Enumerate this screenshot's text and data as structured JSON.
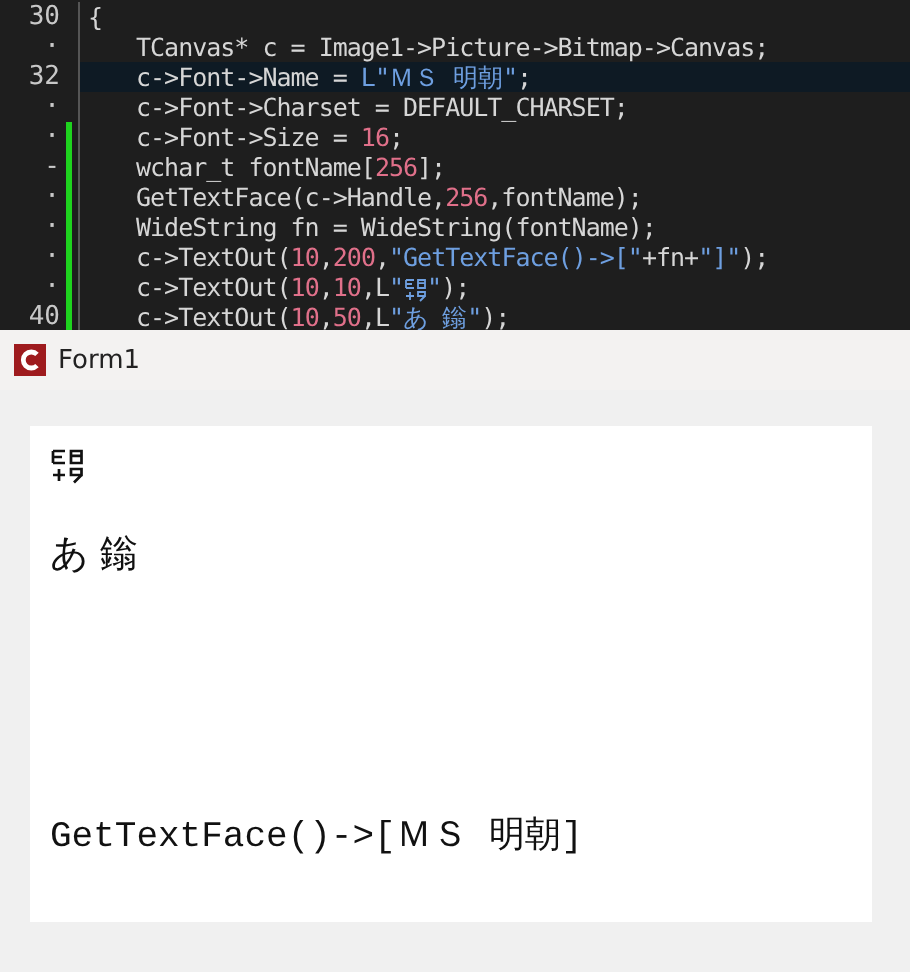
{
  "editor": {
    "lines": [
      {
        "gutter": "30",
        "changed": false,
        "current": false,
        "indented": false,
        "tokens": [
          {
            "kind": "text",
            "text": "{"
          }
        ]
      },
      {
        "gutter": "·",
        "changed": false,
        "current": false,
        "indented": true,
        "tokens": [
          {
            "kind": "text",
            "text": "TCanvas* c = Image1->Picture->Bitmap->Canvas;"
          }
        ]
      },
      {
        "gutter": "32",
        "changed": false,
        "current": true,
        "indented": true,
        "tokens": [
          {
            "kind": "text",
            "text": "c->Font->Name = "
          },
          {
            "kind": "string",
            "text": "L\"ＭＳ 明朝\""
          },
          {
            "kind": "text",
            "text": ";"
          }
        ]
      },
      {
        "gutter": "·",
        "changed": false,
        "current": false,
        "indented": true,
        "tokens": [
          {
            "kind": "text",
            "text": "c->Font->Charset = DEFAULT_CHARSET;"
          }
        ]
      },
      {
        "gutter": "·",
        "changed": true,
        "current": false,
        "indented": true,
        "tokens": [
          {
            "kind": "text",
            "text": "c->Font->Size = "
          },
          {
            "kind": "number",
            "text": "16"
          },
          {
            "kind": "text",
            "text": ";"
          }
        ]
      },
      {
        "gutter": "-",
        "changed": true,
        "current": false,
        "indented": true,
        "tokens": [
          {
            "kind": "text",
            "text": "wchar_t fontName["
          },
          {
            "kind": "number",
            "text": "256"
          },
          {
            "kind": "text",
            "text": "];"
          }
        ]
      },
      {
        "gutter": "·",
        "changed": true,
        "current": false,
        "indented": true,
        "tokens": [
          {
            "kind": "text",
            "text": "GetTextFace(c->Handle,"
          },
          {
            "kind": "number",
            "text": "256"
          },
          {
            "kind": "text",
            "text": ",fontName);"
          }
        ]
      },
      {
        "gutter": "·",
        "changed": true,
        "current": false,
        "indented": true,
        "tokens": [
          {
            "kind": "text",
            "text": "WideString fn = WideString(fontName);"
          }
        ]
      },
      {
        "gutter": "·",
        "changed": true,
        "current": false,
        "indented": true,
        "tokens": [
          {
            "kind": "text",
            "text": "c->TextOut("
          },
          {
            "kind": "number",
            "text": "10"
          },
          {
            "kind": "text",
            "text": ","
          },
          {
            "kind": "number",
            "text": "200"
          },
          {
            "kind": "text",
            "text": ","
          },
          {
            "kind": "string",
            "text": "\"GetTextFace()->[\""
          },
          {
            "kind": "text",
            "text": "+fn+"
          },
          {
            "kind": "string",
            "text": "\"]\""
          },
          {
            "kind": "text",
            "text": ");"
          }
        ]
      },
      {
        "gutter": "·",
        "changed": true,
        "current": false,
        "indented": true,
        "tokens": [
          {
            "kind": "text",
            "text": "c->TextOut("
          },
          {
            "kind": "number",
            "text": "10"
          },
          {
            "kind": "text",
            "text": ","
          },
          {
            "kind": "number",
            "text": "10"
          },
          {
            "kind": "text",
            "text": ",L"
          },
          {
            "kind": "string",
            "text": "\""
          },
          {
            "kind": "glyph"
          },
          {
            "kind": "string",
            "text": "\""
          },
          {
            "kind": "text",
            "text": ");"
          }
        ]
      },
      {
        "gutter": "40",
        "changed": true,
        "current": false,
        "indented": true,
        "tokens": [
          {
            "kind": "text",
            "text": "c->TextOut("
          },
          {
            "kind": "number",
            "text": "10"
          },
          {
            "kind": "text",
            "text": ","
          },
          {
            "kind": "number",
            "text": "50"
          },
          {
            "kind": "text",
            "text": ",L"
          },
          {
            "kind": "string",
            "text": "\"あ 鎓\""
          },
          {
            "kind": "text",
            "text": ");"
          }
        ]
      }
    ]
  },
  "form": {
    "title": "Form1",
    "canvas_items": [
      {
        "kind": "glyph"
      },
      {
        "kind": "text",
        "text": "あ 鎓"
      },
      {
        "kind": "text",
        "text": "GetTextFace()->[ＭＳ 明朝]"
      }
    ]
  }
}
